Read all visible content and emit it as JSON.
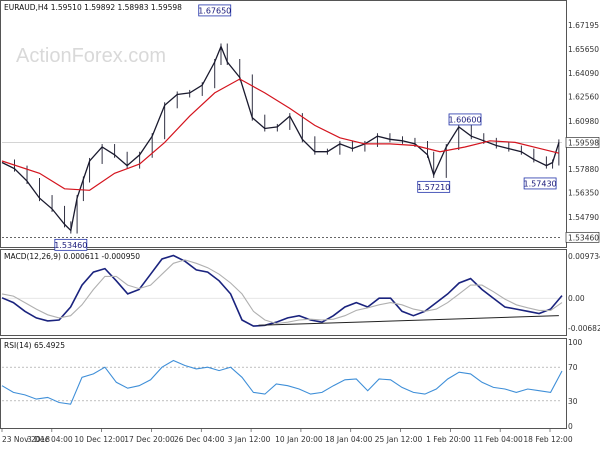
{
  "chart_data": [
    {
      "type": "candlestick",
      "title": "EURAUD,H4 1.59510 1.59892 1.58983 1.59598",
      "watermark": "ActionForex.com",
      "ylim": [
        1.529,
        1.6855
      ],
      "y_ticks": [
        "1.67195",
        "1.65650",
        "1.64090",
        "1.62560",
        "1.60980",
        "1.59598",
        "1.57880",
        "1.56350",
        "1.54790",
        "1.53460"
      ],
      "y_tick_values": [
        1.67195,
        1.6565,
        1.6409,
        1.6256,
        1.6098,
        1.59598,
        1.5788,
        1.5635,
        1.5479,
        1.5346
      ],
      "current_price": "1.59598",
      "support_line": "1.53460",
      "support_value": 1.5346,
      "annotations": [
        {
          "label": "1.67650",
          "x": "27 Dec 08:00",
          "y": 1.6765
        },
        {
          "label": "1.53460",
          "x": "4 Dec 00:00",
          "y": 1.5346
        },
        {
          "label": "1.60600",
          "x": "5 Feb 00:00",
          "y": 1.606
        },
        {
          "label": "1.57210",
          "x": "31 Jan 12:00",
          "y": 1.5721
        },
        {
          "label": "1.57430",
          "x": "17 Feb 12:00",
          "y": 1.5743
        }
      ],
      "close_path": [
        [
          "23 Nov 2018",
          1.583
        ],
        [
          "25 Nov",
          1.579
        ],
        [
          "27 Nov",
          1.571
        ],
        [
          "29 Nov",
          1.56
        ],
        [
          "1 Dec",
          1.553
        ],
        [
          "3 Dec",
          1.543
        ],
        [
          "4 Dec",
          1.539
        ],
        [
          "5 Dec",
          1.56
        ],
        [
          "6 Dec",
          1.572
        ],
        [
          "7 Dec",
          1.584
        ],
        [
          "9 Dec",
          1.593
        ],
        [
          "11 Dec",
          1.588
        ],
        [
          "13 Dec",
          1.581
        ],
        [
          "15 Dec",
          1.588
        ],
        [
          "17 Dec",
          1.6
        ],
        [
          "19 Dec",
          1.62
        ],
        [
          "21 Dec",
          1.627
        ],
        [
          "23 Dec",
          1.628
        ],
        [
          "25 Dec",
          1.633
        ],
        [
          "27 Dec",
          1.648
        ],
        [
          "28 Dec",
          1.658
        ],
        [
          "29 Dec",
          1.648
        ],
        [
          "31 Dec",
          1.638
        ],
        [
          "2 Jan",
          1.612
        ],
        [
          "4 Jan",
          1.605
        ],
        [
          "6 Jan",
          1.606
        ],
        [
          "8 Jan",
          1.613
        ],
        [
          "10 Jan",
          1.598
        ],
        [
          "12 Jan",
          1.59
        ],
        [
          "14 Jan",
          1.59
        ],
        [
          "16 Jan",
          1.595
        ],
        [
          "18 Jan",
          1.592
        ],
        [
          "20 Jan",
          1.595
        ],
        [
          "22 Jan",
          1.6
        ],
        [
          "24 Jan",
          1.598
        ],
        [
          "26 Jan",
          1.597
        ],
        [
          "28 Jan",
          1.595
        ],
        [
          "30 Jan",
          1.588
        ],
        [
          "31 Jan",
          1.575
        ],
        [
          "2 Feb",
          1.593
        ],
        [
          "4 Feb",
          1.606
        ],
        [
          "6 Feb",
          1.6
        ],
        [
          "8 Feb",
          1.597
        ],
        [
          "10 Feb",
          1.594
        ],
        [
          "12 Feb",
          1.592
        ],
        [
          "14 Feb",
          1.59
        ],
        [
          "16 Feb",
          1.585
        ],
        [
          "18 Feb",
          1.581
        ],
        [
          "19 Feb",
          1.583
        ],
        [
          "20 Feb",
          1.596
        ]
      ],
      "ma_path": [
        [
          "23 Nov 2018",
          1.584
        ],
        [
          "29 Nov",
          1.576
        ],
        [
          "3 Dec",
          1.566
        ],
        [
          "7 Dec",
          1.565
        ],
        [
          "11 Dec",
          1.576
        ],
        [
          "15 Dec",
          1.582
        ],
        [
          "19 Dec",
          1.596
        ],
        [
          "23 Dec",
          1.613
        ],
        [
          "27 Dec",
          1.628
        ],
        [
          "31 Dec",
          1.637
        ],
        [
          "4 Jan",
          1.628
        ],
        [
          "8 Jan",
          1.618
        ],
        [
          "12 Jan",
          1.607
        ],
        [
          "16 Jan",
          1.599
        ],
        [
          "20 Jan",
          1.595
        ],
        [
          "24 Jan",
          1.595
        ],
        [
          "28 Jan",
          1.594
        ],
        [
          "1 Feb",
          1.59
        ],
        [
          "5 Feb",
          1.593
        ],
        [
          "9 Feb",
          1.597
        ],
        [
          "13 Feb",
          1.596
        ],
        [
          "17 Feb",
          1.592
        ],
        [
          "20 Feb",
          1.589
        ]
      ]
    },
    {
      "type": "line",
      "title": "MACD(12,26,9) 0.000611 -0.000950",
      "ylim": [
        -0.0082,
        0.0106
      ],
      "y_ticks": [
        "0.009734",
        "0.00",
        "-0.006826"
      ],
      "y_tick_values": [
        0.009734,
        0.0,
        -0.006826
      ],
      "series": [
        {
          "values": [
            0.0001,
            -0.001,
            -0.003,
            -0.0045,
            -0.0052,
            -0.005,
            -0.002,
            0.003,
            0.006,
            0.0068,
            0.004,
            0.001,
            0.002,
            0.0055,
            0.009,
            0.0098,
            0.0085,
            0.0065,
            0.006,
            0.004,
            0.001,
            -0.005,
            -0.0064,
            -0.0062,
            -0.0055,
            -0.0045,
            -0.004,
            -0.005,
            -0.0055,
            -0.004,
            -0.002,
            -0.001,
            -0.002,
            0.0,
            0.0,
            -0.003,
            -0.004,
            -0.003,
            -0.001,
            0.001,
            0.0035,
            0.0045,
            0.002,
            0.0,
            -0.002,
            -0.0025,
            -0.003,
            -0.0035,
            -0.0025,
            0.0006
          ]
        },
        {
          "values": [
            0.001,
            0.0005,
            -0.001,
            -0.0025,
            -0.0038,
            -0.0045,
            -0.004,
            -0.0015,
            0.002,
            0.005,
            0.005,
            0.003,
            0.0022,
            0.003,
            0.0055,
            0.008,
            0.0088,
            0.008,
            0.007,
            0.0055,
            0.0035,
            0.001,
            -0.003,
            -0.005,
            -0.0058,
            -0.0055,
            -0.005,
            -0.0048,
            -0.005,
            -0.0048,
            -0.004,
            -0.0028,
            -0.0022,
            -0.0015,
            -0.001,
            -0.0015,
            -0.0025,
            -0.003,
            -0.0025,
            -0.001,
            0.001,
            0.003,
            0.003,
            0.0015,
            -0.0002,
            -0.0015,
            -0.0022,
            -0.0028,
            -0.0028,
            -0.001
          ]
        }
      ],
      "trendline": [
        [
          "3 Jan",
          -0.0062
        ],
        [
          "20 Feb",
          -0.004
        ]
      ]
    },
    {
      "type": "line",
      "title": "RSI(14) 65.4925",
      "ylim": [
        0,
        100
      ],
      "y_ticks": [
        "100",
        "70",
        "30",
        "0"
      ],
      "y_tick_values": [
        100,
        70,
        30,
        0
      ],
      "reference_lines": [
        70,
        30
      ],
      "series": [
        {
          "values": [
            48,
            40,
            37,
            32,
            34,
            28,
            26,
            58,
            62,
            70,
            52,
            45,
            48,
            55,
            70,
            78,
            72,
            68,
            70,
            66,
            70,
            58,
            40,
            38,
            50,
            48,
            44,
            38,
            40,
            48,
            55,
            56,
            42,
            56,
            55,
            46,
            40,
            38,
            44,
            56,
            64,
            62,
            52,
            46,
            44,
            40,
            44,
            42,
            40,
            65.4925
          ]
        }
      ]
    }
  ],
  "x_ticks": [
    "23 Nov 2018",
    "3 Dec 04:00",
    "10 Dec 12:00",
    "17 Dec 20:00",
    "26 Dec 04:00",
    "3 Jan 12:00",
    "10 Jan 20:00",
    "18 Jan 04:00",
    "25 Jan 12:00",
    "1 Feb 20:00",
    "11 Feb 04:00",
    "18 Feb 12:00"
  ],
  "colors": {
    "price": "#1a1a2e",
    "ma": "#d4141e",
    "macd": "#1a237e",
    "signal": "#b0b0b0",
    "rsi": "#3f8fd8",
    "label_border": "#2233aa"
  }
}
